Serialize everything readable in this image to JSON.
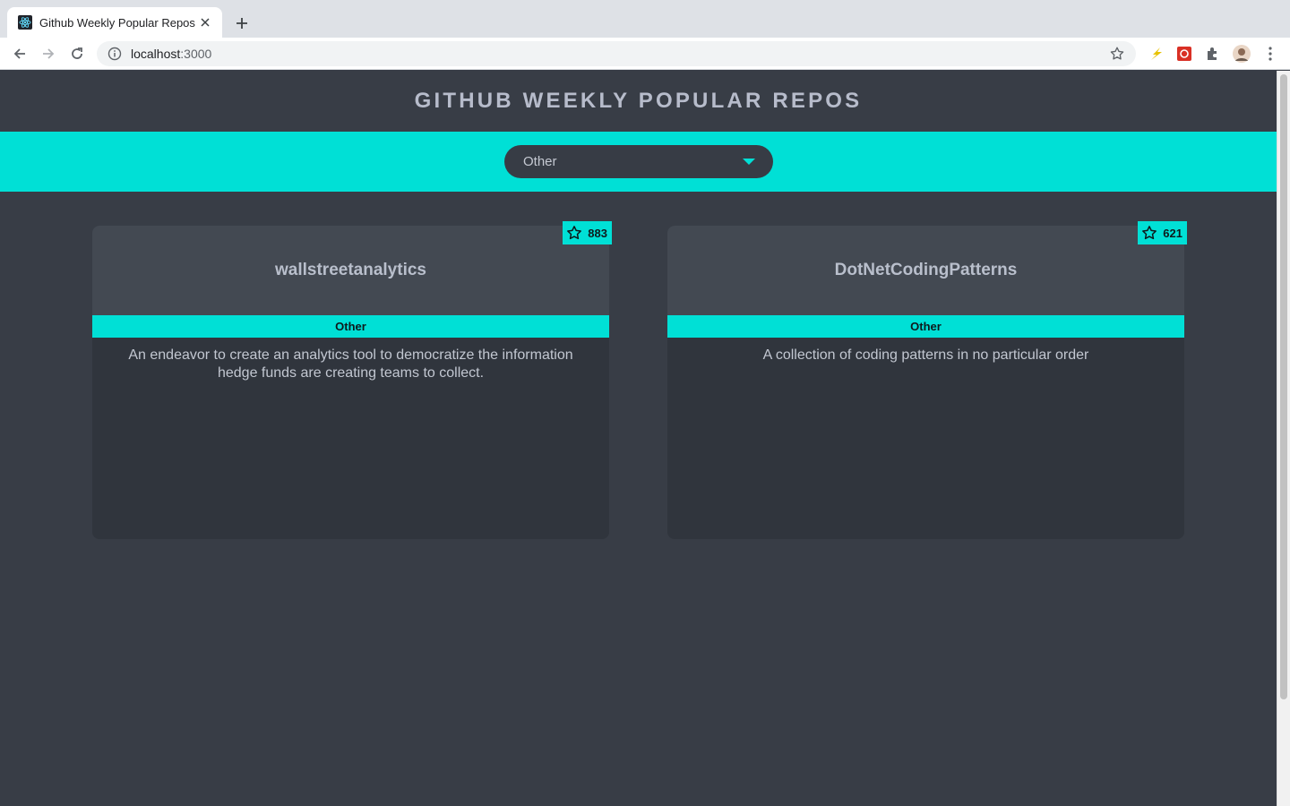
{
  "browser": {
    "tab_title": "Github Weekly Popular Repos",
    "url_host": "localhost",
    "url_port": ":3000"
  },
  "page": {
    "title": "GITHUB WEEKLY POPULAR REPOS",
    "filter": {
      "selected": "Other"
    },
    "accent_color": "#00e0d6",
    "background_color": "#383d46"
  },
  "repos": [
    {
      "name": "wallstreetanalytics",
      "stars": "883",
      "language": "Other",
      "description": "An endeavor to create an analytics tool to democratize the information hedge funds are creating teams to collect."
    },
    {
      "name": "DotNetCodingPatterns",
      "stars": "621",
      "language": "Other",
      "description": "A collection of coding patterns in no particular order"
    }
  ],
  "icons": {
    "favicon": "react-icon",
    "star": "star-outline-icon",
    "caret": "caret-down-icon"
  }
}
